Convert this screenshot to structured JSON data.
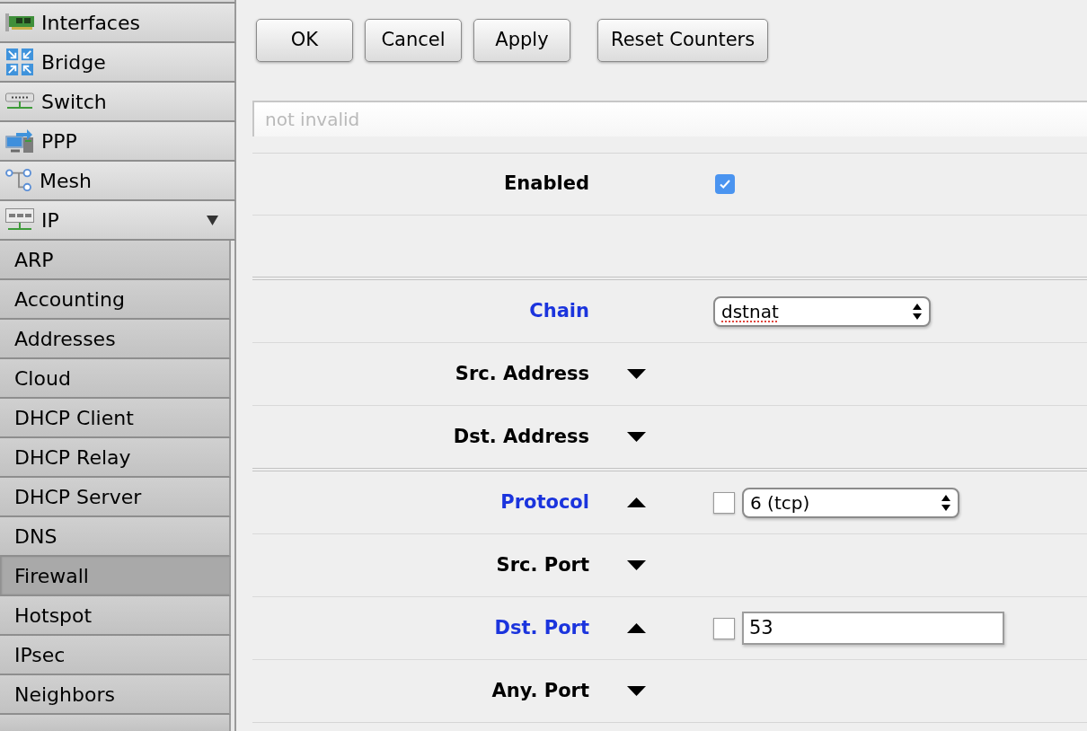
{
  "sidebar": {
    "items": [
      {
        "label": "Interfaces",
        "selected": false
      },
      {
        "label": "Bridge",
        "selected": false
      },
      {
        "label": "Switch",
        "selected": false
      },
      {
        "label": "PPP",
        "selected": false
      },
      {
        "label": "Mesh",
        "selected": false
      },
      {
        "label": "IP",
        "selected": false,
        "expanded": true,
        "children": [
          {
            "label": "ARP",
            "selected": false
          },
          {
            "label": "Accounting",
            "selected": false
          },
          {
            "label": "Addresses",
            "selected": false
          },
          {
            "label": "Cloud",
            "selected": false
          },
          {
            "label": "DHCP Client",
            "selected": false
          },
          {
            "label": "DHCP Relay",
            "selected": false
          },
          {
            "label": "DHCP Server",
            "selected": false
          },
          {
            "label": "DNS",
            "selected": false
          },
          {
            "label": "Firewall",
            "selected": true
          },
          {
            "label": "Hotspot",
            "selected": false
          },
          {
            "label": "IPsec",
            "selected": false
          },
          {
            "label": "Neighbors",
            "selected": false
          }
        ]
      }
    ]
  },
  "toolbar": {
    "groups": [
      [
        "OK",
        "Cancel",
        "Apply"
      ],
      [
        "Reset Counters"
      ]
    ]
  },
  "comment": {
    "placeholder": "not invalid"
  },
  "sections": [
    {
      "rows": [
        {
          "label": "Enabled",
          "active": false,
          "field": {
            "kind": "checkbox",
            "checked": true
          }
        }
      ]
    },
    {
      "rows": [
        {
          "label": "Chain",
          "active": true,
          "field": {
            "kind": "select",
            "value": "dstnat",
            "misspelled": true
          }
        },
        {
          "label": "Src. Address",
          "active": false,
          "expanded": false
        },
        {
          "label": "Dst. Address",
          "active": false,
          "expanded": false
        }
      ]
    },
    {
      "rows": [
        {
          "label": "Protocol",
          "active": true,
          "expanded": true,
          "negate": {
            "checked": false
          },
          "field": {
            "kind": "select",
            "value": "6 (tcp)",
            "misspelled": false
          }
        },
        {
          "label": "Src. Port",
          "active": false,
          "expanded": false
        },
        {
          "label": "Dst. Port",
          "active": true,
          "expanded": true,
          "negate": {
            "checked": false
          },
          "field": {
            "kind": "text",
            "value": "53"
          }
        },
        {
          "label": "Any. Port",
          "active": false,
          "expanded": false
        }
      ]
    }
  ]
}
